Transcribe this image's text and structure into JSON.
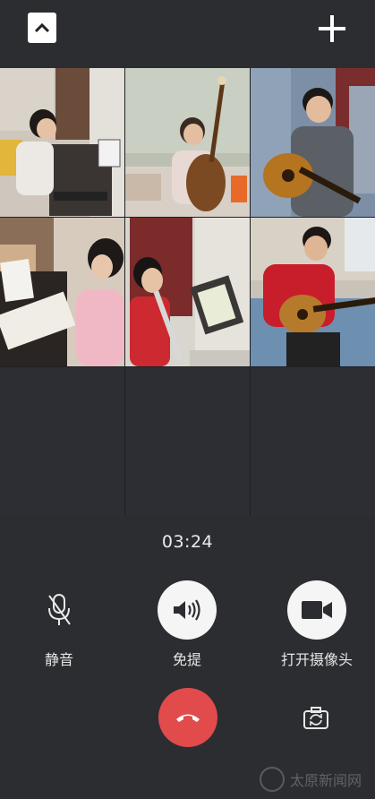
{
  "call": {
    "duration": "03:24"
  },
  "controls": {
    "mute_label": "静音",
    "speaker_label": "免提",
    "camera_label": "打开摄像头"
  },
  "icons": {
    "collapse": "chevron-up-icon",
    "add": "plus-icon",
    "mute": "microphone-icon",
    "speaker": "speaker-icon",
    "camera": "video-camera-icon",
    "hangup": "hangup-phone-icon",
    "flip": "switch-camera-icon"
  },
  "colors": {
    "background": "#2b2d31",
    "hangup": "#e14b4b",
    "button": "#f5f5f5"
  },
  "watermark": {
    "text": "太原新闻网"
  }
}
